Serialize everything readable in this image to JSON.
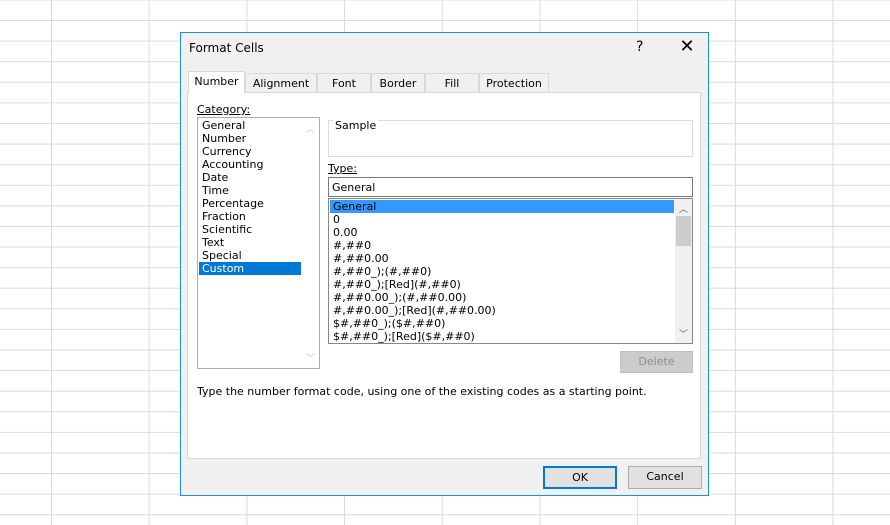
{
  "dialog": {
    "title": "Format Cells",
    "help": "?",
    "close": "✕"
  },
  "tabs": [
    {
      "label": "Number"
    },
    {
      "label": "Alignment"
    },
    {
      "label": "Font"
    },
    {
      "label": "Border"
    },
    {
      "label": "Fill"
    },
    {
      "label": "Protection"
    }
  ],
  "category": {
    "label": "Category:",
    "items": [
      "General",
      "Number",
      "Currency",
      "Accounting",
      "Date",
      "Time",
      "Percentage",
      "Fraction",
      "Scientific",
      "Text",
      "Special",
      "Custom"
    ],
    "selected": "Custom"
  },
  "sample": {
    "label": "Sample"
  },
  "type": {
    "label": "Type:",
    "value": "General",
    "items": [
      "General",
      "0",
      "0.00",
      "#,##0",
      "#,##0.00",
      "#,##0_);(#,##0)",
      "#,##0_);[Red](#,##0)",
      "#,##0.00_);(#,##0.00)",
      "#,##0.00_);[Red](#,##0.00)",
      "$#,##0_);($#,##0)",
      "$#,##0_);[Red]($#,##0)"
    ],
    "selected": "General"
  },
  "delete_label": "Delete",
  "description": "Type the number format code, using one of the existing codes as a starting point.",
  "ok_label": "OK",
  "cancel_label": "Cancel",
  "colors": {
    "accent": "#0078d7",
    "border": "#1e8fd6"
  }
}
